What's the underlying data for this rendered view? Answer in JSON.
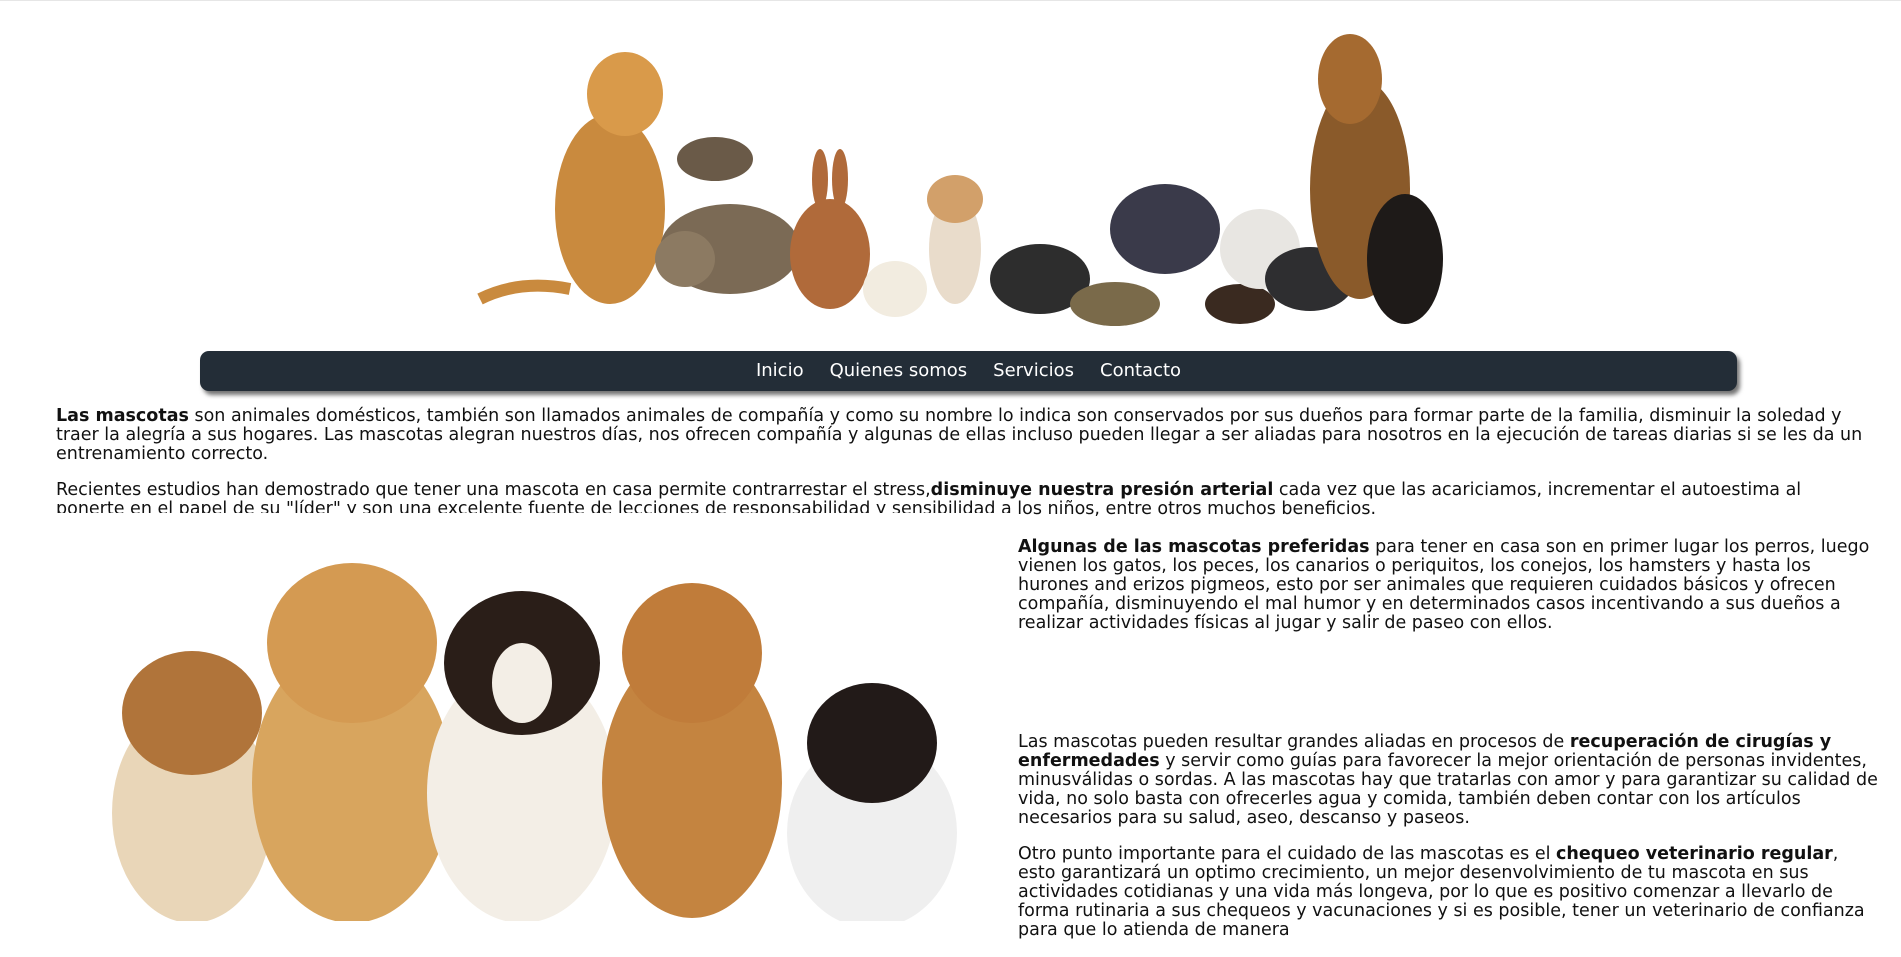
{
  "banner": {
    "alt": ""
  },
  "nav": {
    "items": [
      "Inicio",
      "Quienes somos",
      "Servicios",
      "Contacto"
    ]
  },
  "intro": {
    "p1_bold": "Las mascotas",
    "p1_rest": " son animales domésticos, también son llamados animales de compañía y como su nombre lo indica son conservados por sus dueños para formar parte de la familia, disminuir la soledad y traer la alegría a sus hogares. Las mascotas alegran nuestros días, nos ofrecen compañía y algunas de ellas incluso pueden llegar a ser aliadas para nosotros en la ejecución de tareas diarias si se les da un entrenamiento correcto.",
    "p2_start": "Recientes estudios han demostrado que tener una mascota en casa permite contrarrestar el stress,",
    "p2_bold": "disminuye nuestra presión arterial",
    "p2_rest": " cada vez que las acariciamos, incrementar el autoestima al ponerte en el papel de su \"líder\" y son una excelente fuente de lecciones de responsabilidad y sensibilidad a los niños, entre otros muchos beneficios."
  },
  "side": {
    "s1_bold": "Algunas de las mascotas preferidas",
    "s1_rest": " para tener en casa son en primer lugar los perros, luego vienen los gatos, los peces, los canarios o periquitos, los conejos, los hamsters y hasta los hurones and erizos pigmeos, esto por ser animales que requieren cuidados básicos y ofrecen compañía, disminuyendo el mal humor y en determinados casos incentivando a sus dueños a realizar actividades físicas al jugar y salir de paseo con ellos.",
    "s2_start": "Las mascotas pueden resultar grandes aliadas en procesos de ",
    "s2_bold": "recuperación de cirugías y enfermedades",
    "s2_rest": " y servir como guías para favorecer la mejor orientación de personas invidentes, minusválidas o sordas. A las mascotas hay que tratarlas con amor y para garantizar su calidad de vida, no solo basta con ofrecerles agua y comida, también deben contar con los artículos necesarios para su salud, aseo, descanso y paseos.",
    "s3_start": "Otro punto importante para el cuidado de las mascotas es el ",
    "s3_bold": "chequeo veterinario regular",
    "s3_rest": ", esto garantizará un optimo crecimiento, un mejor desenvolvimiento de tu mascota en sus actividades cotidianas y una vida más longeva, por lo que es positivo comenzar a llevarlo de forma rutinaria a sus chequeos y vacunaciones y si es posible, tener un veterinario de confianza para que lo atienda de manera"
  },
  "colors": {
    "nav_bg": "#232d37",
    "nav_text": "#ffffff"
  }
}
